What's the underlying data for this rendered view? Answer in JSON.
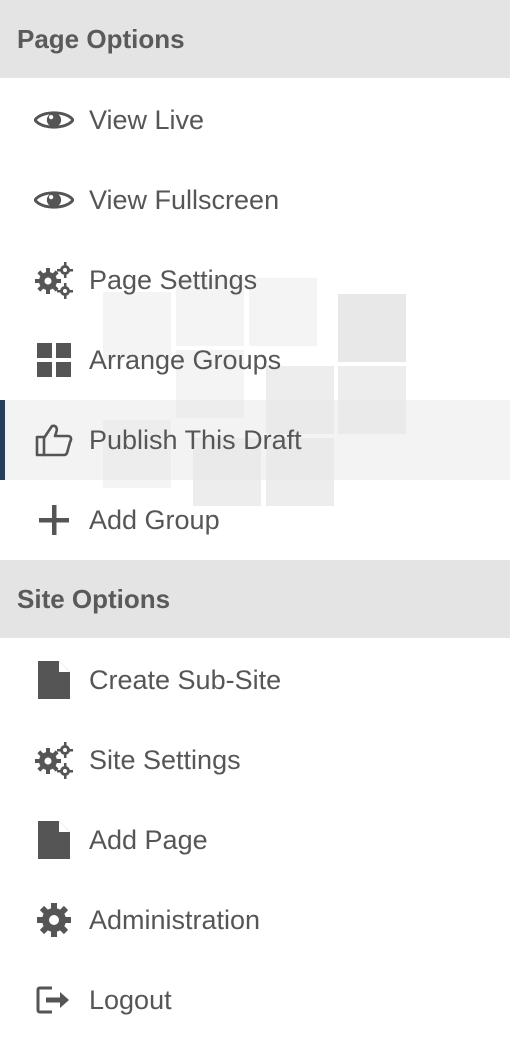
{
  "page_options": {
    "title": "Page Options",
    "items": [
      {
        "label": "View Live",
        "icon": "eye-icon"
      },
      {
        "label": "View Fullscreen",
        "icon": "eye-icon"
      },
      {
        "label": "Page Settings",
        "icon": "gears-icon"
      },
      {
        "label": "Arrange Groups",
        "icon": "grid-icon"
      },
      {
        "label": "Publish This Draft",
        "icon": "thumbs-up-icon",
        "active": true
      },
      {
        "label": "Add Group",
        "icon": "plus-icon"
      }
    ]
  },
  "site_options": {
    "title": "Site Options",
    "items": [
      {
        "label": "Create Sub-Site",
        "icon": "file-icon"
      },
      {
        "label": "Site Settings",
        "icon": "gears-icon"
      },
      {
        "label": "Add Page",
        "icon": "file-icon"
      },
      {
        "label": "Administration",
        "icon": "gear-icon"
      },
      {
        "label": "Logout",
        "icon": "logout-icon"
      }
    ]
  },
  "colors": {
    "header_bg": "#e4e4e4",
    "active_bar": "#263e5a",
    "text": "#565656",
    "icon": "#555555"
  }
}
